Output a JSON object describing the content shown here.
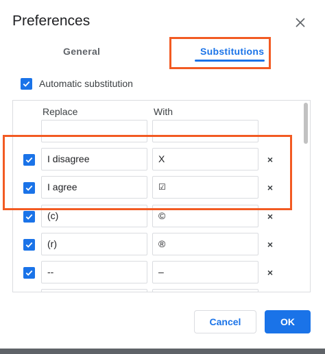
{
  "dialog": {
    "title": "Preferences",
    "close_icon": "close-icon"
  },
  "tabs": [
    {
      "label": "General",
      "selected": false
    },
    {
      "label": "Substitutions",
      "selected": true
    }
  ],
  "auto_substitution": {
    "label": "Automatic substitution",
    "checked": true
  },
  "table": {
    "headers": {
      "replace": "Replace",
      "with": "With"
    },
    "new_row": {
      "replace": "",
      "with": ""
    },
    "rows": [
      {
        "checked": true,
        "replace": "I disagree",
        "with": "X",
        "delete_icon": "close-icon"
      },
      {
        "checked": true,
        "replace": "I agree",
        "with": "☑",
        "delete_icon": "close-icon"
      },
      {
        "checked": true,
        "replace": "(c)",
        "with": "©",
        "delete_icon": "close-icon"
      },
      {
        "checked": true,
        "replace": "(r)",
        "with": "®",
        "delete_icon": "close-icon"
      },
      {
        "checked": true,
        "replace": "--",
        "with": "–",
        "delete_icon": "close-icon"
      }
    ],
    "delete_glyph": "×"
  },
  "buttons": {
    "cancel": "Cancel",
    "ok": "OK"
  },
  "colors": {
    "accent": "#1a73e8",
    "highlight": "#f25a22",
    "border": "#dadce0"
  }
}
